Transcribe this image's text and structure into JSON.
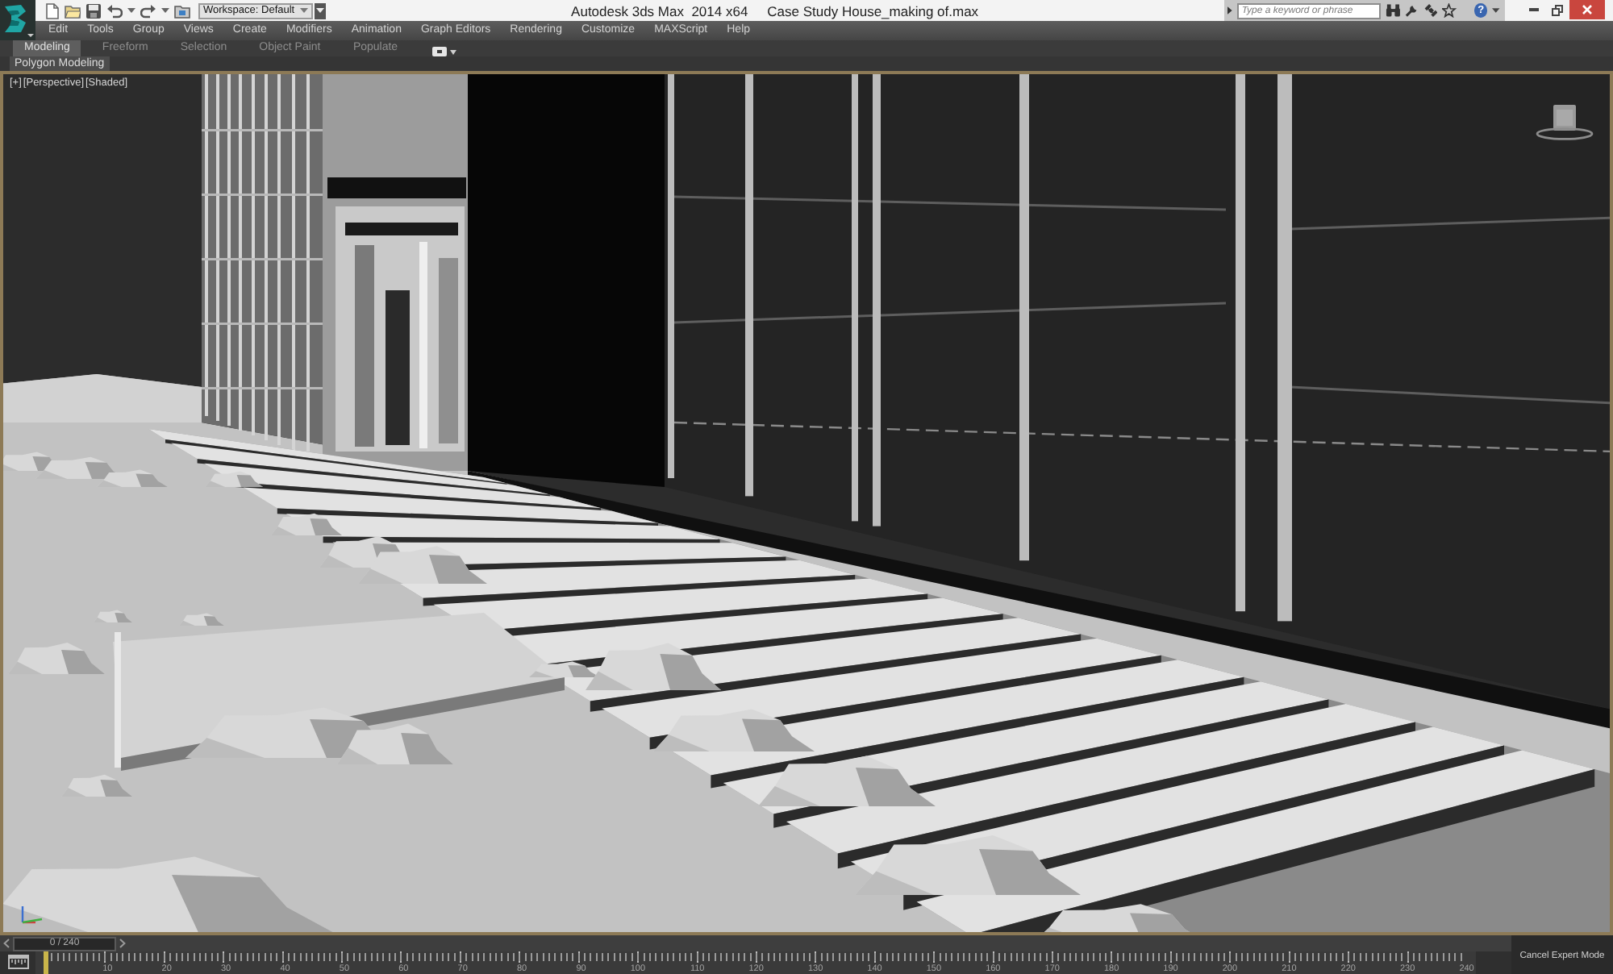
{
  "title_bar": {
    "app_title": "Autodesk 3ds Max  2014 x64",
    "file_name": "Case Study House_making of.max",
    "workspace": "Workspace: Default",
    "search": {
      "placeholder": "Type a keyword or phrase"
    },
    "help_button": "?"
  },
  "menu_bar": [
    "Edit",
    "Tools",
    "Group",
    "Views",
    "Create",
    "Modifiers",
    "Animation",
    "Graph Editors",
    "Rendering",
    "Customize",
    "MAXScript",
    "Help"
  ],
  "ribbon": {
    "tabs": [
      {
        "label": "Modeling",
        "selected": true
      },
      {
        "label": "Freeform",
        "selected": false
      },
      {
        "label": "Selection",
        "selected": false
      },
      {
        "label": "Object Paint",
        "selected": false
      },
      {
        "label": "Populate",
        "selected": false
      }
    ],
    "panel": "Polygon Modeling"
  },
  "viewport": {
    "labels": [
      "[+]",
      "[Perspective]",
      "[Shaded]"
    ]
  },
  "time_slider": {
    "reading": "0 / 240",
    "level": 0
  },
  "track_bar": {
    "ticks": [
      "10",
      "20",
      "30",
      "40",
      "50",
      "60",
      "70",
      "80",
      "90",
      "100",
      "110",
      "120",
      "130",
      "140",
      "150",
      "160",
      "170",
      "180",
      "190",
      "200",
      "210",
      "220",
      "230",
      "240"
    ]
  },
  "expert_mode": {
    "button": "Cancel Expert Mode"
  }
}
